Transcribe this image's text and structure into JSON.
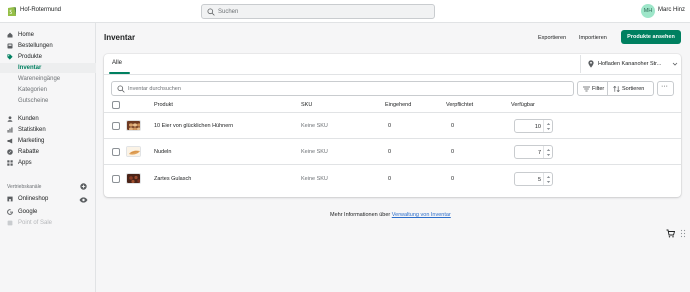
{
  "topbar": {
    "store_name": "Hof-Rotermund",
    "search_placeholder": "Suchen",
    "user_initials": "MH",
    "user_name": "Marc Hinz"
  },
  "sidebar": {
    "items": [
      {
        "label": "Home",
        "icon": "home-icon"
      },
      {
        "label": "Bestellungen",
        "icon": "orders-icon"
      },
      {
        "label": "Produkte",
        "icon": "tag-icon"
      },
      {
        "label": "Inventar",
        "active": true
      },
      {
        "label": "Wareneingänge"
      },
      {
        "label": "Kategorien"
      },
      {
        "label": "Gutscheine"
      },
      {
        "label": "Kunden",
        "icon": "person-icon"
      },
      {
        "label": "Statistiken",
        "icon": "chart-icon"
      },
      {
        "label": "Marketing",
        "icon": "megaphone-icon"
      },
      {
        "label": "Rabatte",
        "icon": "discount-icon"
      },
      {
        "label": "Apps",
        "icon": "apps-icon"
      }
    ],
    "channels_label": "Vertriebskanäle",
    "channels": [
      {
        "label": "Onlineshop",
        "icon": "store-icon"
      },
      {
        "label": "Google",
        "icon": "google-icon"
      },
      {
        "label": "Point of Sale",
        "icon": "pos-icon",
        "disabled": true
      }
    ]
  },
  "page": {
    "title": "Inventar",
    "export_label": "Exportieren",
    "import_label": "Importieren",
    "primary_label": "Produkte ansehen"
  },
  "card": {
    "tab_label": "Alle",
    "location": "Hofladen Kananoher Str...",
    "filter_placeholder": "Inventar durchsuchen",
    "filter_label": "Filter",
    "sort_label": "Sortieren",
    "more_label": "···",
    "columns": [
      "Produkt",
      "SKU",
      "Eingehend",
      "Verpflichtet",
      "Verfügbar"
    ],
    "rows": [
      {
        "product": "10 Eier von glücklichen Hühnern",
        "sku": "Keine SKU",
        "incoming": "0",
        "committed": "0",
        "available": "10",
        "thumb_color": "#8a4b2d"
      },
      {
        "product": "Nudeln",
        "sku": "Keine SKU",
        "incoming": "0",
        "committed": "0",
        "available": "7",
        "thumb_color": "#e2a35a"
      },
      {
        "product": "Zartes Gulasch",
        "sku": "Keine SKU",
        "incoming": "0",
        "committed": "0",
        "available": "5",
        "thumb_color": "#6b2e1f"
      }
    ]
  },
  "footer": {
    "prefix": "Mehr Informationen über ",
    "link": "Verwaltung von Inventar"
  },
  "colors": {
    "primary": "#008060",
    "link": "#2c6ecb",
    "avatar_bg": "#9ee6c9"
  }
}
